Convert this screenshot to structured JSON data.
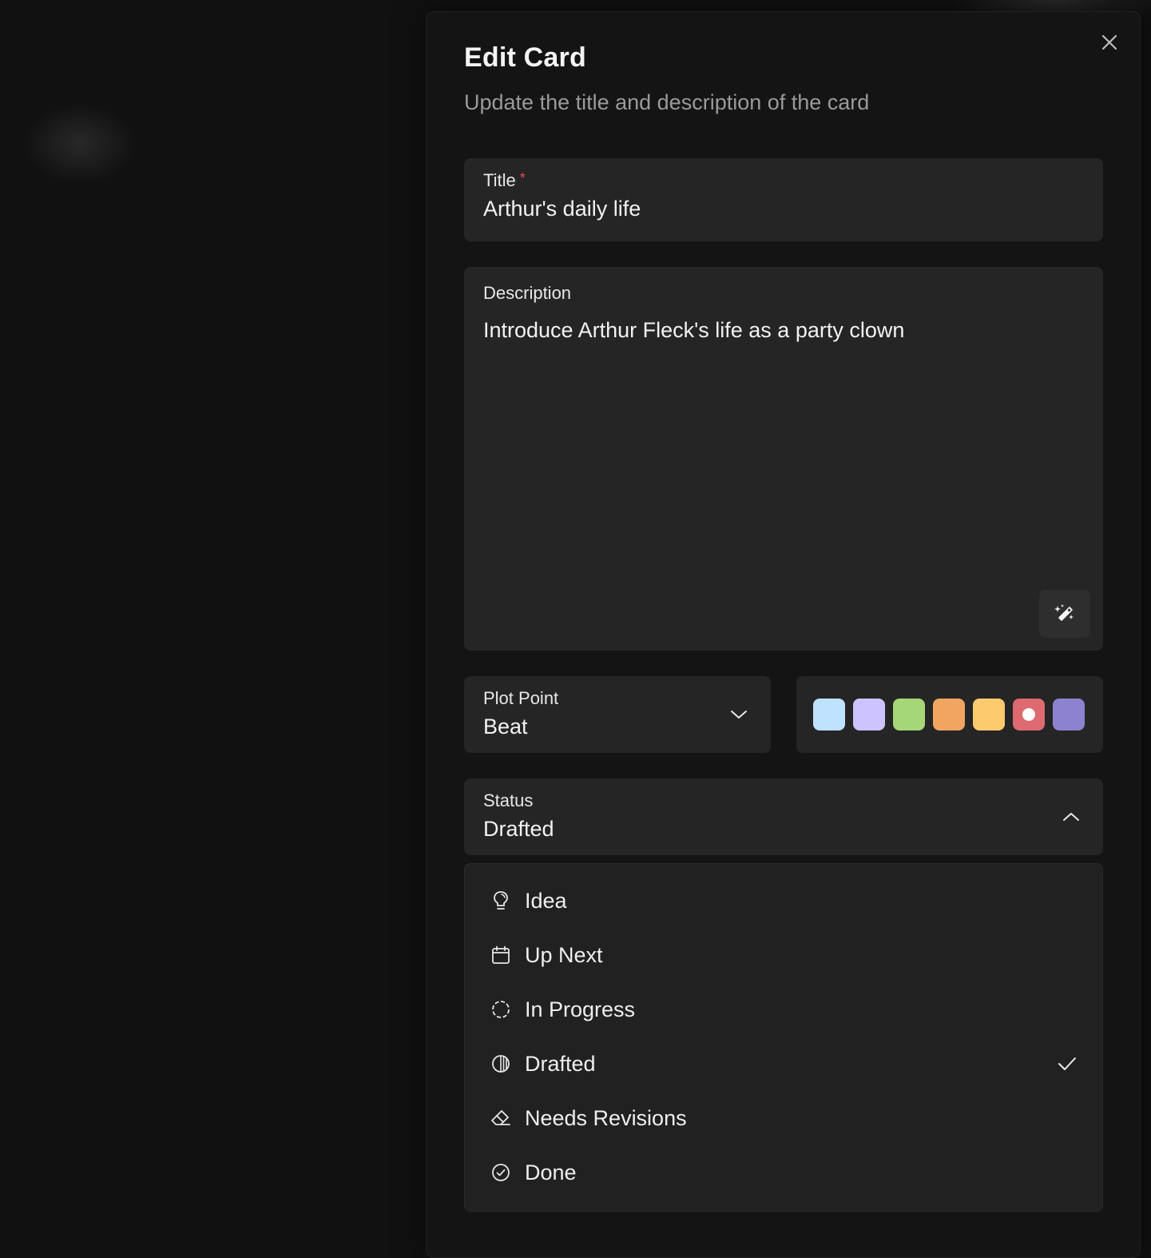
{
  "modal": {
    "title": "Edit Card",
    "subtitle": "Update the title and description of the card",
    "close_icon": "close-icon"
  },
  "title_field": {
    "label": "Title",
    "required_marker": "*",
    "value": "Arthur's daily life"
  },
  "description_field": {
    "label": "Description",
    "value": "Introduce Arthur Fleck's life as a party clown",
    "ai_button_icon": "magic-wand-icon"
  },
  "plot_point": {
    "label": "Plot Point",
    "value": "Beat",
    "icon": "chevron-down-icon"
  },
  "colors": {
    "options": [
      {
        "name": "light-blue",
        "hex": "#bfe2fe",
        "selected": false
      },
      {
        "name": "lavender",
        "hex": "#cdc3fe",
        "selected": false
      },
      {
        "name": "green",
        "hex": "#a5d678",
        "selected": false
      },
      {
        "name": "orange",
        "hex": "#f2a461",
        "selected": false
      },
      {
        "name": "yellow",
        "hex": "#fdca6e",
        "selected": false
      },
      {
        "name": "red",
        "hex": "#dc6a70",
        "selected": true
      },
      {
        "name": "purple",
        "hex": "#8c82cf",
        "selected": false
      }
    ]
  },
  "status": {
    "label": "Status",
    "value": "Drafted",
    "icon": "chevron-up-icon",
    "options": [
      {
        "label": "Idea",
        "icon": "lightbulb-icon",
        "selected": false
      },
      {
        "label": "Up Next",
        "icon": "calendar-icon",
        "selected": false
      },
      {
        "label": "In Progress",
        "icon": "dashed-circle-icon",
        "selected": false
      },
      {
        "label": "Drafted",
        "icon": "half-circle-icon",
        "selected": true
      },
      {
        "label": "Needs Revisions",
        "icon": "eraser-icon",
        "selected": false
      },
      {
        "label": "Done",
        "icon": "check-circle-icon",
        "selected": false
      }
    ]
  }
}
